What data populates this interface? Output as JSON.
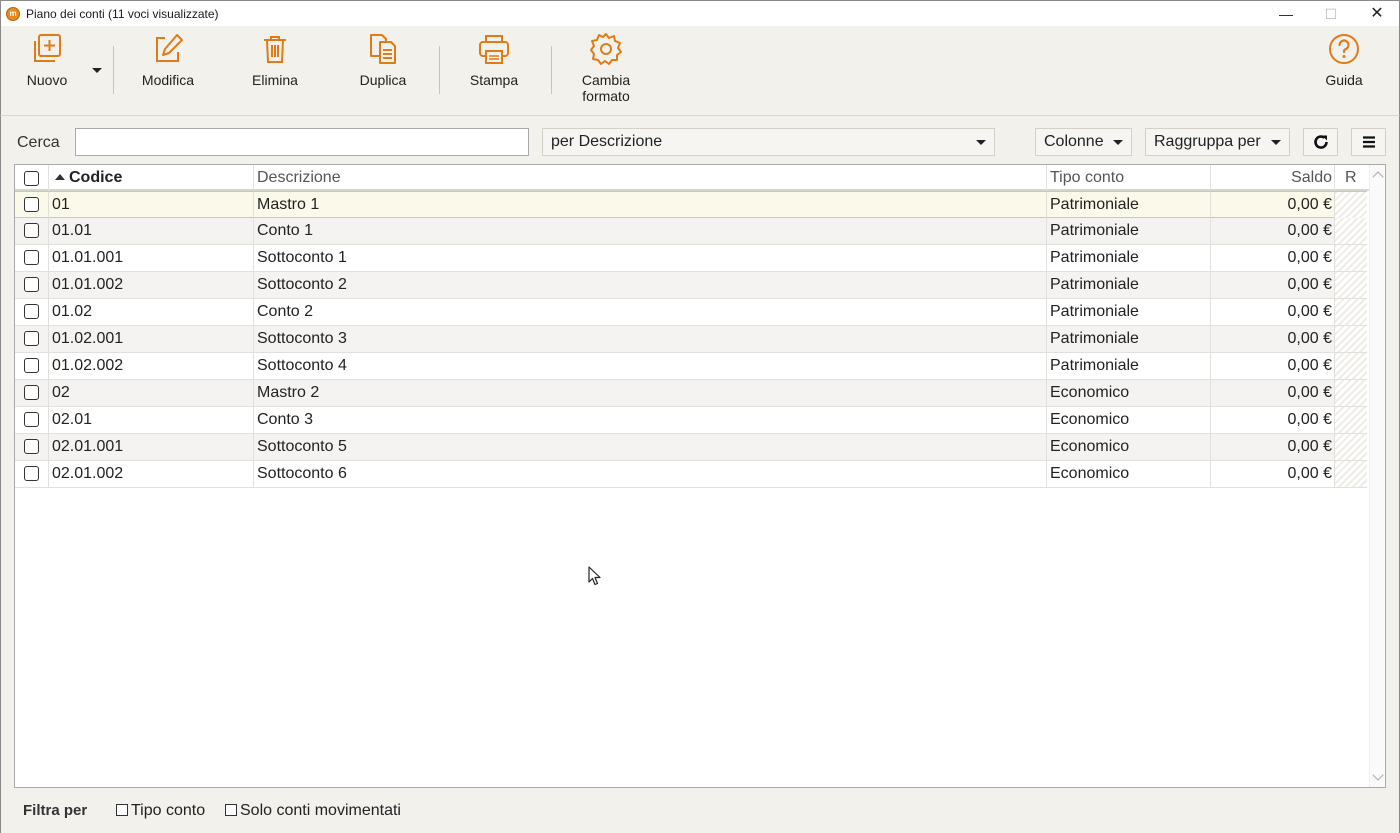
{
  "window": {
    "title": "Piano dei conti (11 voci visualizzate)",
    "app_icon_letter": "m",
    "minimize_glyph": "—",
    "maximize_glyph": "☐",
    "close_glyph": "✕"
  },
  "toolbar": {
    "new_label": "Nuovo",
    "edit_label": "Modifica",
    "delete_label": "Elimina",
    "duplicate_label": "Duplica",
    "print_label": "Stampa",
    "format_label_1": "Cambia",
    "format_label_2": "formato",
    "help_label": "Guida",
    "accent_color": "#e07b1a"
  },
  "search": {
    "label": "Cerca",
    "value": "",
    "placeholder": "",
    "by_field": "per Descrizione",
    "columns": "Colonne",
    "group_by": "Raggruppa per"
  },
  "table": {
    "headers": {
      "code": "Codice",
      "description": "Descrizione",
      "type": "Tipo conto",
      "balance": "Saldo",
      "r": "R"
    },
    "sorted_column": "code",
    "sort_direction": "ascending",
    "rows": [
      {
        "code": "01",
        "description": "Mastro 1",
        "type": "Patrimoniale",
        "balance": "0,00 €",
        "selected": true
      },
      {
        "code": "01.01",
        "description": "Conto 1",
        "type": "Patrimoniale",
        "balance": "0,00 €"
      },
      {
        "code": "01.01.001",
        "description": "Sottoconto 1",
        "type": "Patrimoniale",
        "balance": "0,00 €"
      },
      {
        "code": "01.01.002",
        "description": "Sottoconto 2",
        "type": "Patrimoniale",
        "balance": "0,00 €"
      },
      {
        "code": "01.02",
        "description": "Conto 2",
        "type": "Patrimoniale",
        "balance": "0,00 €"
      },
      {
        "code": "01.02.001",
        "description": "Sottoconto 3",
        "type": "Patrimoniale",
        "balance": "0,00 €"
      },
      {
        "code": "01.02.002",
        "description": "Sottoconto 4",
        "type": "Patrimoniale",
        "balance": "0,00 €"
      },
      {
        "code": "02",
        "description": "Mastro 2",
        "type": "Economico",
        "balance": "0,00 €"
      },
      {
        "code": "02.01",
        "description": "Conto 3",
        "type": "Economico",
        "balance": "0,00 €"
      },
      {
        "code": "02.01.001",
        "description": "Sottoconto 5",
        "type": "Economico",
        "balance": "0,00 €"
      },
      {
        "code": "02.01.002",
        "description": "Sottoconto 6",
        "type": "Economico",
        "balance": "0,00 €"
      }
    ]
  },
  "filters": {
    "label": "Filtra per",
    "account_type": "Tipo conto",
    "only_moved": "Solo conti movimentati"
  }
}
